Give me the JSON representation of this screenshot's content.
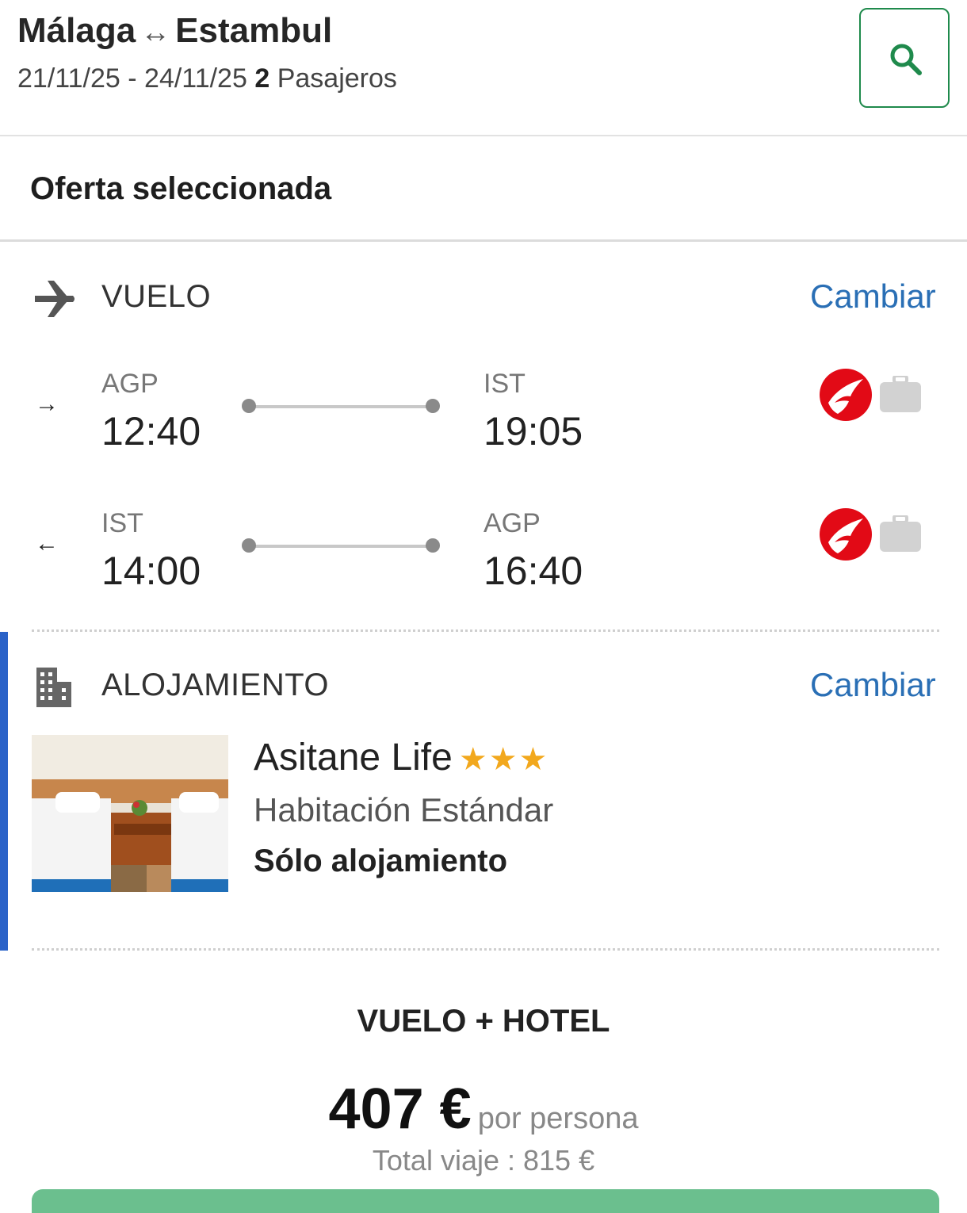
{
  "header": {
    "origin": "Málaga",
    "route_arrow": "↔",
    "destination": "Estambul",
    "dates": "21/11/25 - 24/11/25",
    "passengers_count": "2",
    "passengers_label": "Pasajeros",
    "search_icon": "search-icon",
    "accent_color": "#1f8a4c"
  },
  "offer": {
    "title": "Oferta seleccionada"
  },
  "flight": {
    "section_label": "VUELO",
    "change_label": "Cambiar",
    "icon": "airplane-icon",
    "legs": [
      {
        "direction_glyph": "→",
        "from_code": "AGP",
        "from_time": "12:40",
        "to_code": "IST",
        "to_time": "19:05",
        "airline_logo": "turkish-airlines-logo",
        "baggage_icon": "suitcase-icon"
      },
      {
        "direction_glyph": "←",
        "from_code": "IST",
        "from_time": "14:00",
        "to_code": "AGP",
        "to_time": "16:40",
        "airline_logo": "turkish-airlines-logo",
        "baggage_icon": "suitcase-icon"
      }
    ]
  },
  "accommodation": {
    "section_label": "ALOJAMIENTO",
    "change_label": "Cambiar",
    "icon": "building-icon",
    "hotel_name": "Asitane Life",
    "stars": "★★★",
    "star_color": "#f2a81d",
    "room_type": "Habitación Estándar",
    "board": "Sólo alojamiento",
    "image": "hotel-room-photo"
  },
  "price": {
    "package_label": "VUELO + HOTEL",
    "per_person_amount": "407 €",
    "per_person_label": "por persona",
    "total_label": "Total viaje : 815 €"
  },
  "colors": {
    "link": "#2a6fb5",
    "section_bar": "#2a62c8",
    "airline_red": "#e20a16"
  }
}
